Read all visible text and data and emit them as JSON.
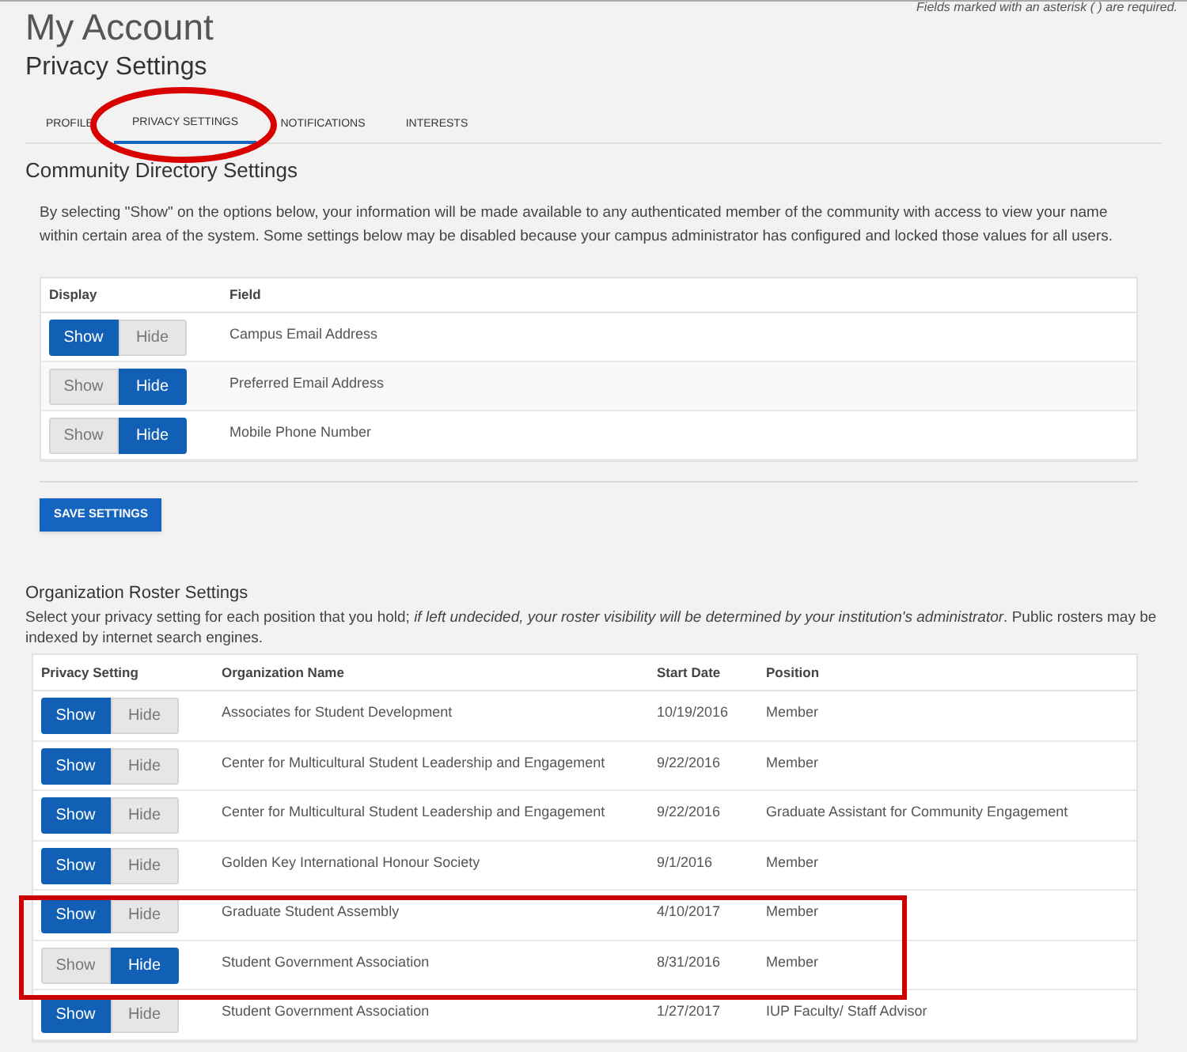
{
  "required_note": "Fields marked with an asterisk ( ) are required.",
  "page_title": "My Account",
  "subtitle": "Privacy Settings",
  "tabs": [
    {
      "label": "PROFILE",
      "selected": false
    },
    {
      "label": "PRIVACY SETTINGS",
      "selected": true
    },
    {
      "label": "NOTIFICATIONS",
      "selected": false
    },
    {
      "label": "INTERESTS",
      "selected": false
    }
  ],
  "directory": {
    "heading": "Community Directory Settings",
    "description": "By selecting \"Show\" on the options below, your information will be made available to any authenticated member of the community with access to view your name within certain area of the system. Some settings below may be disabled because your campus administrator has configured and locked those values for all users.",
    "columns": [
      "Display",
      "Field"
    ],
    "rows": [
      {
        "show_label": "Show",
        "hide_label": "Hide",
        "shown": true,
        "field": "Campus Email Address"
      },
      {
        "show_label": "Show",
        "hide_label": "Hide",
        "shown": false,
        "field": "Preferred Email Address"
      },
      {
        "show_label": "Show",
        "hide_label": "Hide",
        "shown": false,
        "field": "Mobile Phone Number"
      }
    ],
    "save_button": "SAVE SETTINGS"
  },
  "roster": {
    "heading": "Organization Roster Settings",
    "description": "Select your privacy setting for each position that you hold; *if left undecided, your roster visibility will be determined by your institution's administrator*. Public rosters may be indexed by internet search engines.",
    "columns": [
      "Privacy Setting",
      "Organization Name",
      "Start Date",
      "Position"
    ],
    "rows": [
      {
        "show_label": "Show",
        "hide_label": "Hide",
        "shown": true,
        "organization": "Associates for Student Development",
        "start_date": "10/19/2016",
        "position": "Member"
      },
      {
        "show_label": "Show",
        "hide_label": "Hide",
        "shown": true,
        "organization": "Center for Multicultural Student Leadership and Engagement",
        "start_date": "9/22/2016",
        "position": "Member"
      },
      {
        "show_label": "Show",
        "hide_label": "Hide",
        "shown": true,
        "organization": "Center for Multicultural Student Leadership and Engagement",
        "start_date": "9/22/2016",
        "position": "Graduate Assistant for Community Engagement"
      },
      {
        "show_label": "Show",
        "hide_label": "Hide",
        "shown": true,
        "organization": "Golden Key International Honour Society",
        "start_date": "9/1/2016",
        "position": "Member"
      },
      {
        "show_label": "Show",
        "hide_label": "Hide",
        "shown": true,
        "organization": "Graduate Student Assembly",
        "start_date": "4/10/2017",
        "position": "Member"
      },
      {
        "show_label": "Show",
        "hide_label": "Hide",
        "shown": false,
        "organization": "Student Government Association",
        "start_date": "8/31/2016",
        "position": "Member"
      },
      {
        "show_label": "Show",
        "hide_label": "Hide",
        "shown": true,
        "organization": "Student Government Association",
        "start_date": "1/27/2017",
        "position": "IUP Faculty/ Staff Advisor"
      }
    ]
  }
}
